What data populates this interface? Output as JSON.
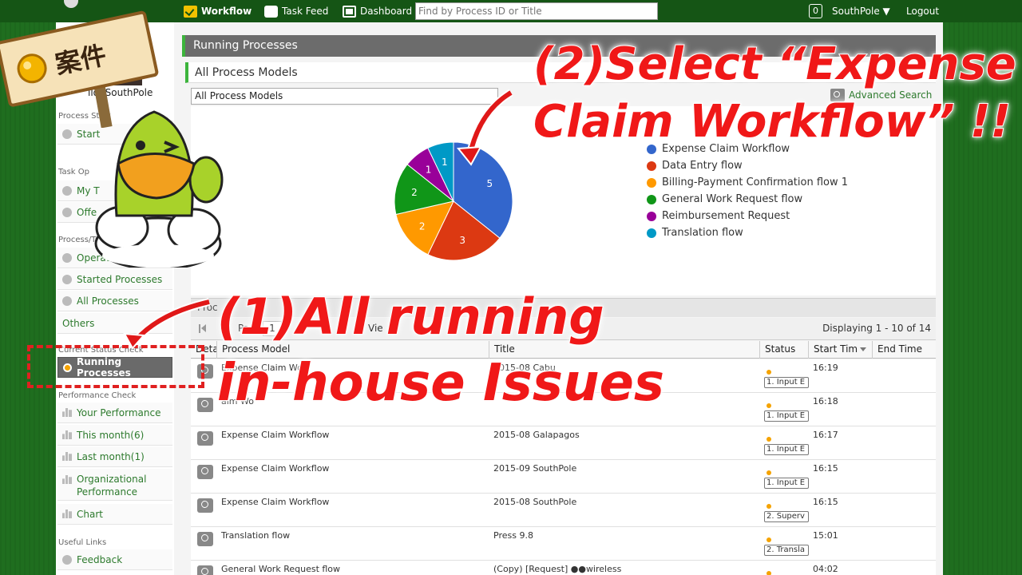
{
  "topbar": {
    "workflow": "Workflow",
    "task_feed": "Task Feed",
    "dashboard": "Dashboard",
    "search_placeholder": "Find by Process ID or Title",
    "notification_count": "0",
    "user": "SouthPole ▼",
    "logout": "Logout"
  },
  "sidebar": {
    "hello": "llo, SouthPole",
    "process_start_heading": "Process Start",
    "start": "Start",
    "task_op_heading": "Task Op",
    "my_tasks": "My T",
    "offer": "Offe",
    "process_task_heading": "Process/Task",
    "operated_tasks": "Operated Tasks",
    "started_processes": "Started Processes",
    "all_processes": "All Processes",
    "others": "Others",
    "current_status_heading": "Current Status Check",
    "running_processes": "Running Processes",
    "performance_heading": "Performance Check",
    "your_performance": "Your Performance",
    "this_month": "This month(6)",
    "last_month": "Last month(1)",
    "org_perf_1": "Organizational",
    "org_perf_2": "Performance",
    "chart": "Chart",
    "useful_links_heading": "Useful Links",
    "feedback": "Feedback"
  },
  "main": {
    "running_header": "Running Processes",
    "models_header": "All Process Models",
    "model_select": "All Process Models",
    "advanced_search": "Advanced Search"
  },
  "chart_data": {
    "type": "pie",
    "labels": [
      "Expense Claim Workflow",
      "Data Entry flow",
      "Billing-Payment Confirmation flow 1",
      "General Work Request flow",
      "Reimbursement Request",
      "Translation flow"
    ],
    "values": [
      5,
      3,
      2,
      2,
      1,
      1
    ],
    "colors": [
      "#3366cc",
      "#dc3912",
      "#ff9900",
      "#109618",
      "#990099",
      "#0099c6"
    ],
    "legend_position": "right"
  },
  "table": {
    "section_label": "Proc",
    "page_label": "Pa",
    "page_value": "1",
    "view_label": "Vie",
    "displaying": "Displaying 1 - 10 of 14",
    "columns": [
      "Deta",
      "Process Model",
      "Title",
      "Status",
      "Start Tim",
      "End Time"
    ],
    "rows": [
      {
        "model": "Expense Claim Wor",
        "title": "2015-08 Cabu",
        "status": "1. Input E",
        "start": "16:19"
      },
      {
        "model": "aim Wo",
        "title": "",
        "status": "1. Input E",
        "start": "16:18"
      },
      {
        "model": "Expense Claim Workflow",
        "title": "2015-08 Galapagos",
        "status": "1. Input E",
        "start": "16:17"
      },
      {
        "model": "Expense Claim Workflow",
        "title": "2015-09 SouthPole",
        "status": "1. Input E",
        "start": "16:15"
      },
      {
        "model": "Expense Claim Workflow",
        "title": "2015-08 SouthPole",
        "status": "2. Superv",
        "start": "16:15"
      },
      {
        "model": "Translation flow",
        "title": "Press 9.8",
        "status": "2. Transla",
        "start": "15:01"
      },
      {
        "model": "General Work Request flow",
        "title": "(Copy) [Request] ●●wireless",
        "status": "",
        "start": "04:02"
      }
    ]
  },
  "annotations": {
    "sign_text": "案件",
    "step2_line1": "(2)Select “Expense",
    "step2_line2": "Claim Workflow” !!",
    "step1_line1": "(1)All running",
    "step1_line2": "in-house Issues"
  }
}
